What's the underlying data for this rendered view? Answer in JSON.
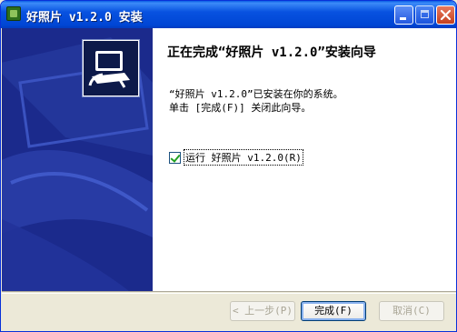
{
  "window": {
    "title": "好照片 v1.2.0 安装",
    "icon": "app-icon",
    "controls": [
      "minimize-icon",
      "maximize-icon",
      "close-icon"
    ]
  },
  "content": {
    "heading": "正在完成“好照片 v1.2.0”安装向导",
    "body_line1": "“好照片 v1.2.0”已安装在你的系统。",
    "body_line2": "单击 [完成(F)] 关闭此向导。",
    "run_checkbox": {
      "label": "运行 好照片 v1.2.0(R)",
      "checked": true
    }
  },
  "buttons": {
    "back": "< 上一步(P)",
    "finish": "完成(F)",
    "cancel": "取消(C)"
  },
  "colors": {
    "titlebar": "#0054E3",
    "banner": "#1B2A8C",
    "dialog_bg": "#ECE9D8",
    "checkmark": "#21A121"
  }
}
